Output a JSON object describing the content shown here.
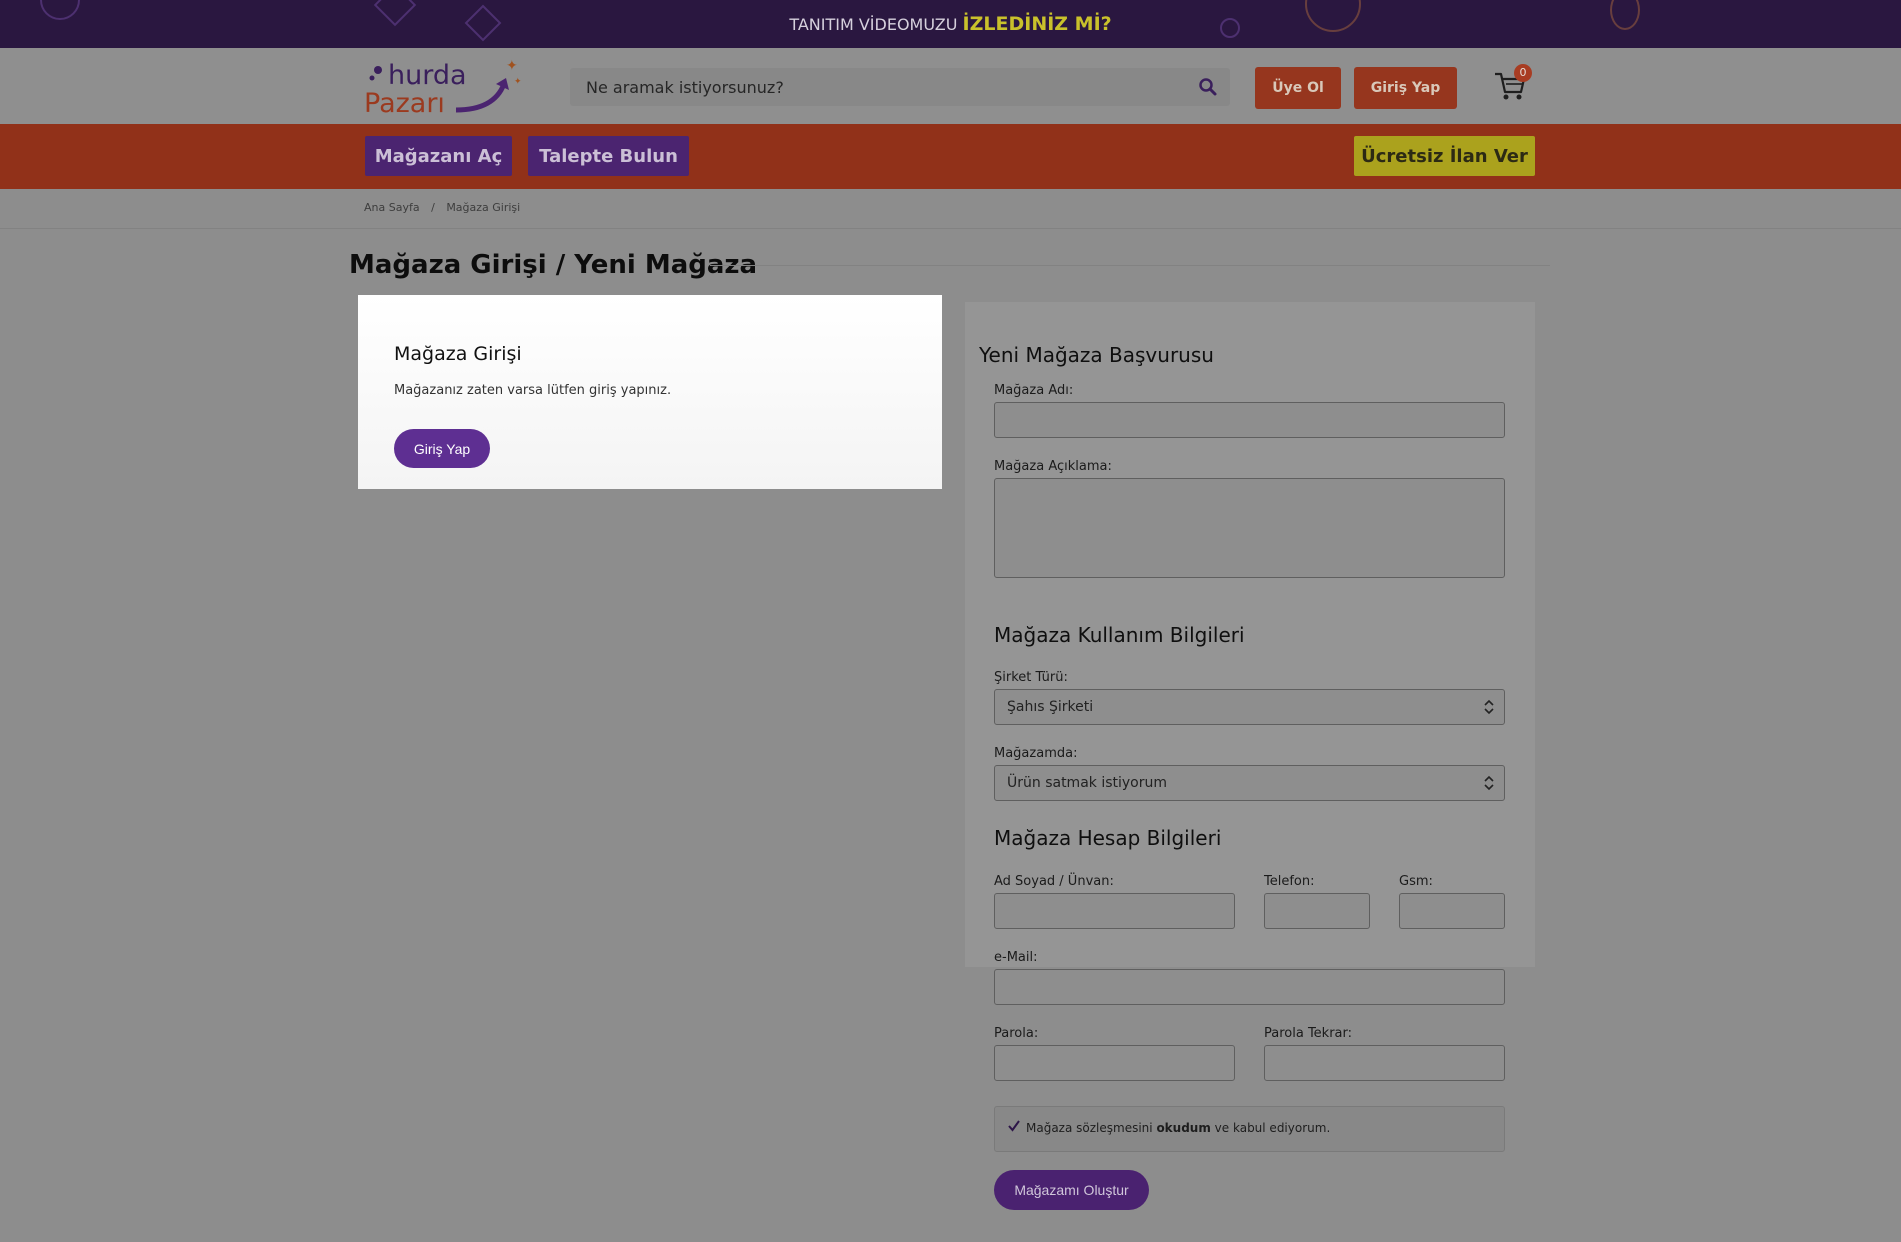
{
  "promo": {
    "text": "TANITIM VİDEOMUZU",
    "highlight": "İZLEDİNİZ Mİ?"
  },
  "header": {
    "logo": {
      "line1": "hurda",
      "line2": "Pazarı"
    },
    "search": {
      "placeholder": "Ne aramak istiyorsunuz?",
      "icon": "search-icon"
    },
    "register_label": "Üye Ol",
    "login_label": "Giriş Yap",
    "cart_count": "0"
  },
  "nav": {
    "open_store": "Mağazanı Aç",
    "find_request": "Talepte Bulun",
    "free_listing": "Ücretsiz İlan Ver"
  },
  "breadcrumb": [
    "Ana Sayfa",
    "/",
    "Mağaza Girişi"
  ],
  "page_title": "Mağaza Girişi / Yeni Mağaza",
  "login_card": {
    "title": "Mağaza Girişi",
    "description": "Mağazanız zaten varsa lütfen giriş yapınız.",
    "button": "Giriş Yap"
  },
  "new_store": {
    "title": "Yeni Mağaza Başvurusu",
    "store_name_label": "Mağaza Adı:",
    "store_desc_label": "Mağaza Açıklama:",
    "usage_title": "Mağaza Kullanım Bilgileri",
    "company_type_label": "Şirket Türü:",
    "company_type_value": "Şahıs Şirketi",
    "store_mode_label": "Mağazamda:",
    "store_mode_value": "Ürün satmak istiyorum",
    "account_title": "Mağaza Hesap Bilgileri",
    "name_label": "Ad Soyad / Ünvan:",
    "phone_label": "Telefon:",
    "gsm_label": "Gsm:",
    "email_label": "e-Mail:",
    "password_label": "Parola:",
    "password_repeat_label": "Parola Tekrar:",
    "agree_prefix": "Mağaza sözleşmesini",
    "agree_bold": "okudum",
    "agree_suffix": "ve kabul ediyorum.",
    "agree_checked": true,
    "submit": "Mağazamı Oluştur"
  }
}
